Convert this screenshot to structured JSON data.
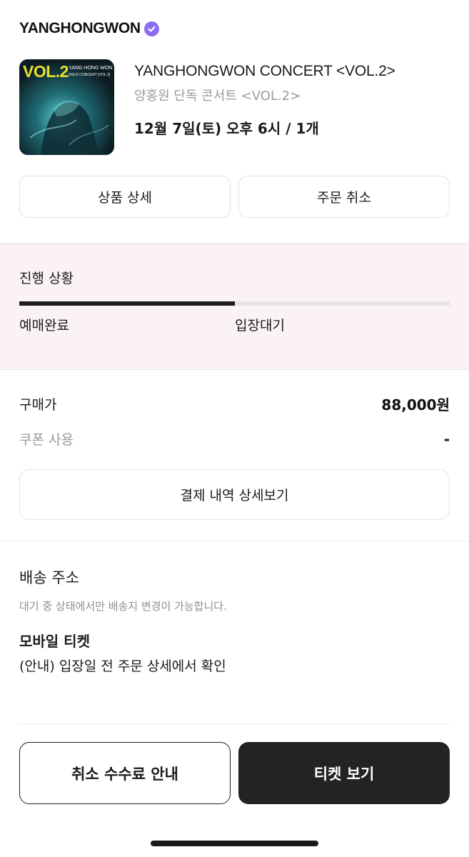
{
  "header": {
    "artist_name": "YANGHONGWON",
    "verified_icon": "verified-check-icon",
    "verified_color": "#8b6cf2"
  },
  "product": {
    "thumbnail": {
      "vol_text": "VOL.2",
      "artist_text": "YANG HONG WON",
      "concert_text": "SOLO CONCERT [VOL.2]"
    },
    "title": "YANGHONGWON CONCERT <VOL.2>",
    "subtitle": "양홍원 단독 콘서트 <VOL.2>",
    "schedule": "12월 7일(토) 오후 6시 / 1개"
  },
  "actions": {
    "product_detail_label": "상품 상세",
    "order_cancel_label": "주문 취소"
  },
  "progress": {
    "title": "진행 상황",
    "fraction": 0.5,
    "steps": [
      "예매완료",
      "입장대기"
    ],
    "background_color": "#fbf3f3"
  },
  "payment": {
    "price_label": "구매가",
    "price_value": "88,000원",
    "coupon_label": "쿠폰 사용",
    "coupon_value": "-",
    "detail_button_label": "결제 내역 상세보기"
  },
  "shipping": {
    "title": "배송 주소",
    "note": "대기 중 상태에서만 배송지 변경이 가능합니다."
  },
  "mobile_ticket": {
    "title": "모바일 티켓",
    "note": "(안내) 입장일 전 주문 상세에서 확인"
  },
  "bottom": {
    "cancel_fee_label": "취소 수수료 안내",
    "view_ticket_label": "티켓 보기",
    "primary_color": "#232323"
  }
}
